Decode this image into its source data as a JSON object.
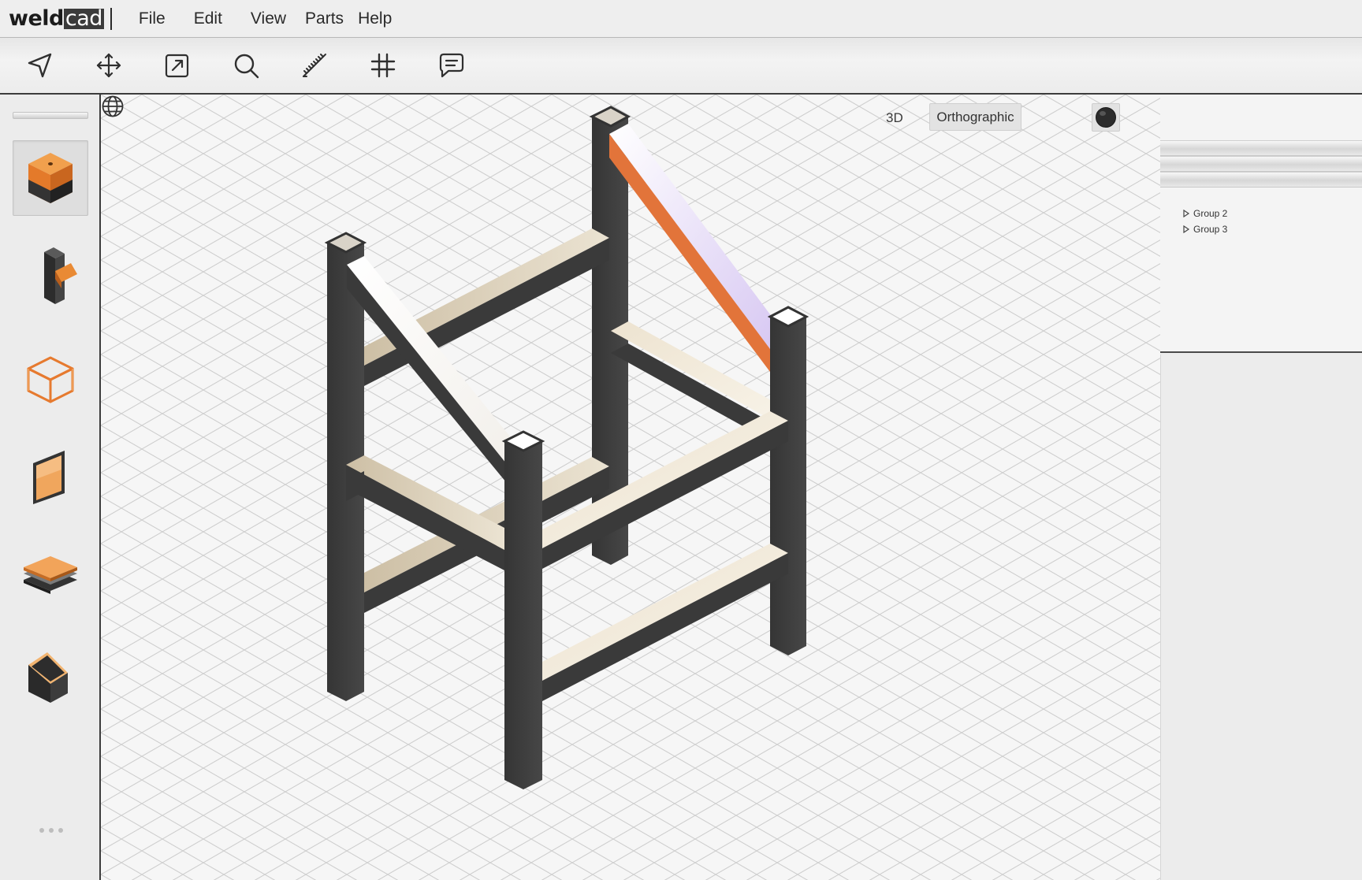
{
  "app": {
    "logo_bold": "weld",
    "logo_boxed": "cad"
  },
  "menu": {
    "items": [
      "File",
      "Edit",
      "View",
      "Parts",
      "Help"
    ]
  },
  "toolbar": {
    "tools": [
      "navigate-icon",
      "move-icon",
      "export-icon",
      "search-icon",
      "ruler-icon",
      "grid-icon",
      "comment-icon"
    ]
  },
  "palette": {
    "parts": [
      "square-tube-part",
      "angle-bracket-part",
      "frame-box-part",
      "panel-part",
      "plate-stack-part",
      "channel-part"
    ],
    "active_index": 0
  },
  "viewport": {
    "view_mode": "3D",
    "projection": "Orthographic",
    "accent_color": "#e67a2f",
    "frame_color": "#3a3a3a"
  },
  "right_panel": {
    "tree": [
      {
        "label": "Group 2"
      },
      {
        "label": "Group 3"
      }
    ]
  }
}
